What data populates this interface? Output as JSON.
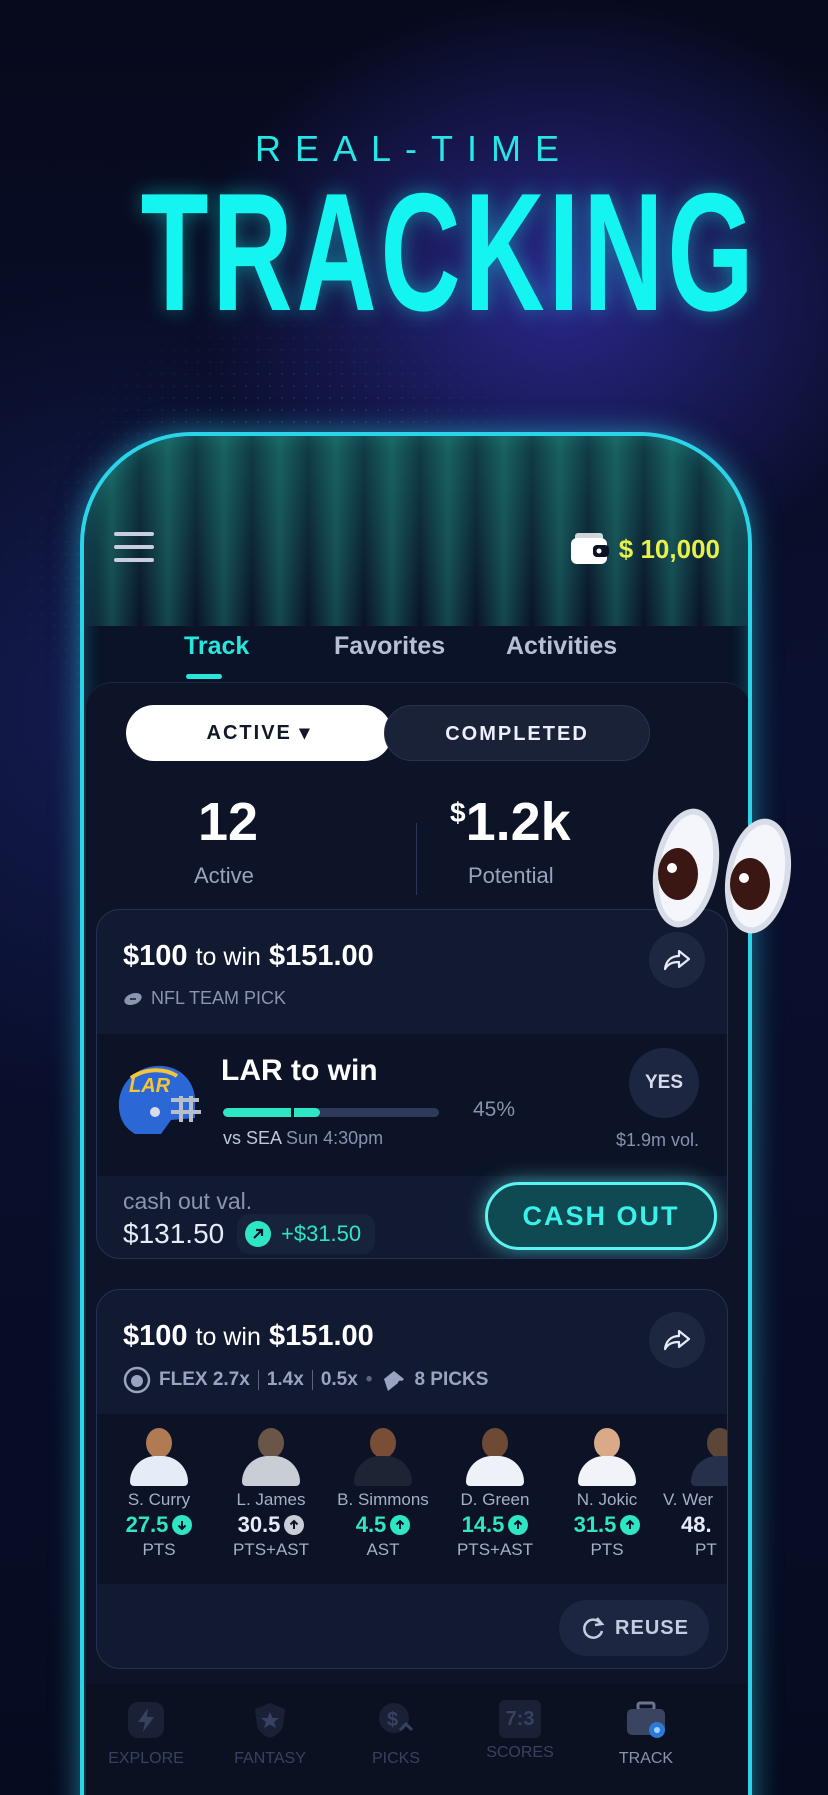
{
  "promo": {
    "subtitle": "REAL-TIME",
    "title": "TRACKING"
  },
  "header": {
    "menu_icon": "hamburger-menu-icon",
    "wallet_icon": "wallet-icon",
    "balance": "$ 10,000",
    "balance_color": "#e8f04a"
  },
  "tabs": [
    {
      "label": "Track",
      "active": true
    },
    {
      "label": "Favorites",
      "active": false
    },
    {
      "label": "Activities",
      "active": false
    }
  ],
  "filter": {
    "active_label": "ACTIVE ▾",
    "completed_label": "COMPLETED"
  },
  "stats": {
    "active_count": "12",
    "active_label": "Active",
    "potential_currency": "$",
    "potential_value": "1.2k",
    "potential_label": "Potential"
  },
  "card1": {
    "stake": "$100",
    "to_win_text": "to win",
    "payout": "$151.00",
    "tag": "NFL TEAM PICK",
    "pick": {
      "team_abbr": "LAR",
      "title": "LAR to win",
      "progress_pct": 45,
      "pct_label": "45%",
      "matchup": "vs SEA",
      "time": "Sun 4:30pm",
      "side_label": "YES",
      "volume": "$1.9m vol."
    },
    "cash_out_label": "cash out val.",
    "cash_out_value": "$131.50",
    "gain": "+$31.50",
    "cash_out_button": "CASH OUT",
    "accent": "#2ee6c4"
  },
  "card2": {
    "stake": "$100",
    "to_win_text": "to win",
    "payout": "$151.00",
    "flex": "FLEX 2.7x",
    "mult2": "1.4x",
    "mult3": "0.5x",
    "picks": "8 PICKS",
    "players": [
      {
        "name": "S. Curry",
        "line": "27.5",
        "direction": "down",
        "stat": "PTS",
        "color": "#2ee6c4"
      },
      {
        "name": "L. James",
        "line": "30.5",
        "direction": "up",
        "stat": "PTS+AST",
        "color": "#e6ebf7"
      },
      {
        "name": "B. Simmons",
        "line": "4.5",
        "direction": "up",
        "stat": "AST",
        "color": "#2ee6c4"
      },
      {
        "name": "D. Green",
        "line": "14.5",
        "direction": "up",
        "stat": "PTS+AST",
        "color": "#2ee6c4"
      },
      {
        "name": "N. Jokic",
        "line": "31.5",
        "direction": "up",
        "stat": "PTS",
        "color": "#2ee6c4"
      },
      {
        "name": "V. Wer",
        "line": "48.",
        "direction": "up",
        "stat": "PT",
        "color": "#e6ebf7"
      }
    ],
    "reuse_button": "REUSE"
  },
  "nav": [
    {
      "label": "EXPLORE",
      "icon": "bolt-icon",
      "active": false
    },
    {
      "label": "FANTASY",
      "icon": "shield-star-icon",
      "active": false
    },
    {
      "label": "PICKS",
      "icon": "dollar-picks-icon",
      "active": false
    },
    {
      "label": "SCORES",
      "icon": "scoreboard-icon",
      "active": false,
      "icon_text": "7:3"
    },
    {
      "label": "TRACK",
      "icon": "briefcase-icon",
      "active": true
    }
  ]
}
